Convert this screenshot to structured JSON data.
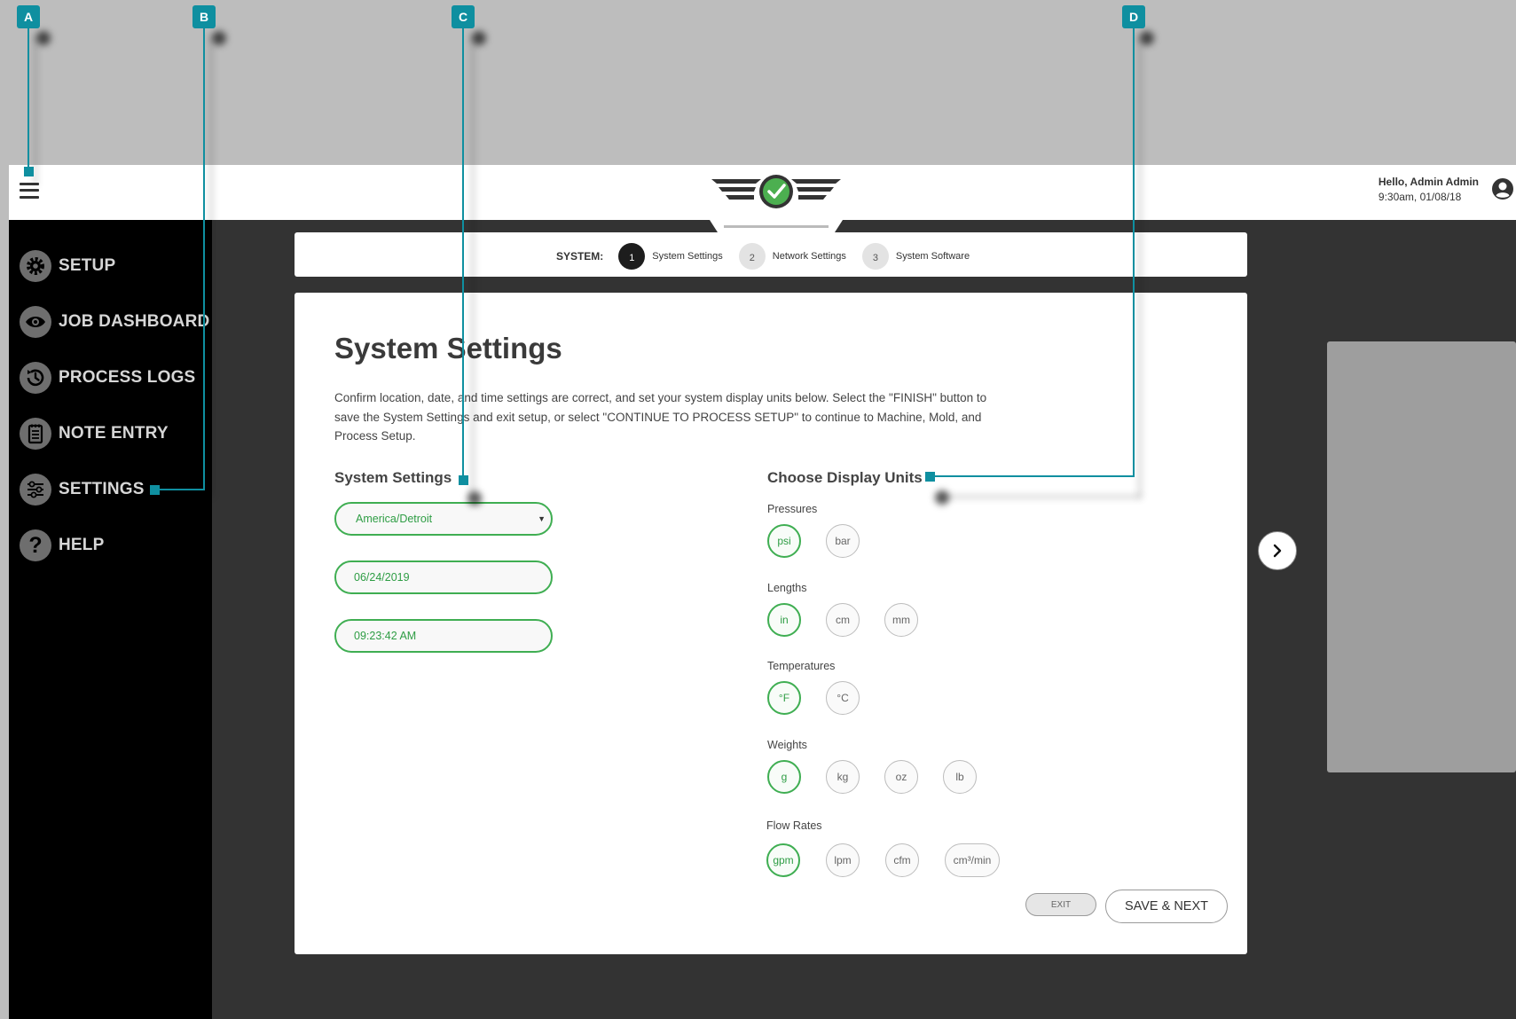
{
  "header": {
    "greeting": "Hello, Admin Admin",
    "datetime": "9:30am, 01/08/18"
  },
  "sidebar": {
    "items": [
      {
        "label": "SETUP",
        "icon": "gear-icon"
      },
      {
        "label": "JOB DASHBOARD",
        "icon": "eye-icon"
      },
      {
        "label": "PROCESS LOGS",
        "icon": "history-icon"
      },
      {
        "label": "NOTE ENTRY",
        "icon": "notepad-icon"
      },
      {
        "label": "SETTINGS",
        "icon": "sliders-icon"
      },
      {
        "label": "HELP",
        "icon": "question-icon"
      }
    ]
  },
  "stepper": {
    "title": "SYSTEM:",
    "steps": [
      {
        "num": "1",
        "label": "System Settings",
        "active": true
      },
      {
        "num": "2",
        "label": "Network Settings",
        "active": false
      },
      {
        "num": "3",
        "label": "System Software",
        "active": false
      }
    ]
  },
  "main": {
    "title": "System Settings",
    "description": "Confirm location, date, and time settings are correct, and set your system display units below. Select the \"FINISH\" button to save the System Settings and exit setup, or select \"CONTINUE TO PROCESS SETUP\" to continue to Machine, Mold, and Process Setup.",
    "system_settings": {
      "heading": "System Settings",
      "timezone": "America/Detroit",
      "date": "06/24/2019",
      "time": "09:23:42 AM"
    },
    "display_units": {
      "heading": "Choose Display Units",
      "groups": [
        {
          "label": "Pressures",
          "options": [
            "psi",
            "bar"
          ],
          "selected": "psi"
        },
        {
          "label": "Lengths",
          "options": [
            "in",
            "cm",
            "mm"
          ],
          "selected": "in"
        },
        {
          "label": "Temperatures",
          "options": [
            "°F",
            "°C"
          ],
          "selected": "°F"
        },
        {
          "label": "Weights",
          "options": [
            "g",
            "kg",
            "oz",
            "lb"
          ],
          "selected": "g"
        },
        {
          "label": "Flow Rates",
          "options": [
            "gpm",
            "lpm",
            "cfm",
            "cm³/min"
          ],
          "selected": "gpm"
        }
      ]
    },
    "buttons": {
      "exit": "EXIT",
      "save_next": "SAVE & NEXT"
    }
  },
  "callouts": [
    "A",
    "B",
    "C",
    "D"
  ],
  "colors": {
    "accent_green": "#3fae52",
    "callout_teal": "#0f8fa0",
    "sidebar_bg": "#000000",
    "content_bg": "#333333"
  }
}
